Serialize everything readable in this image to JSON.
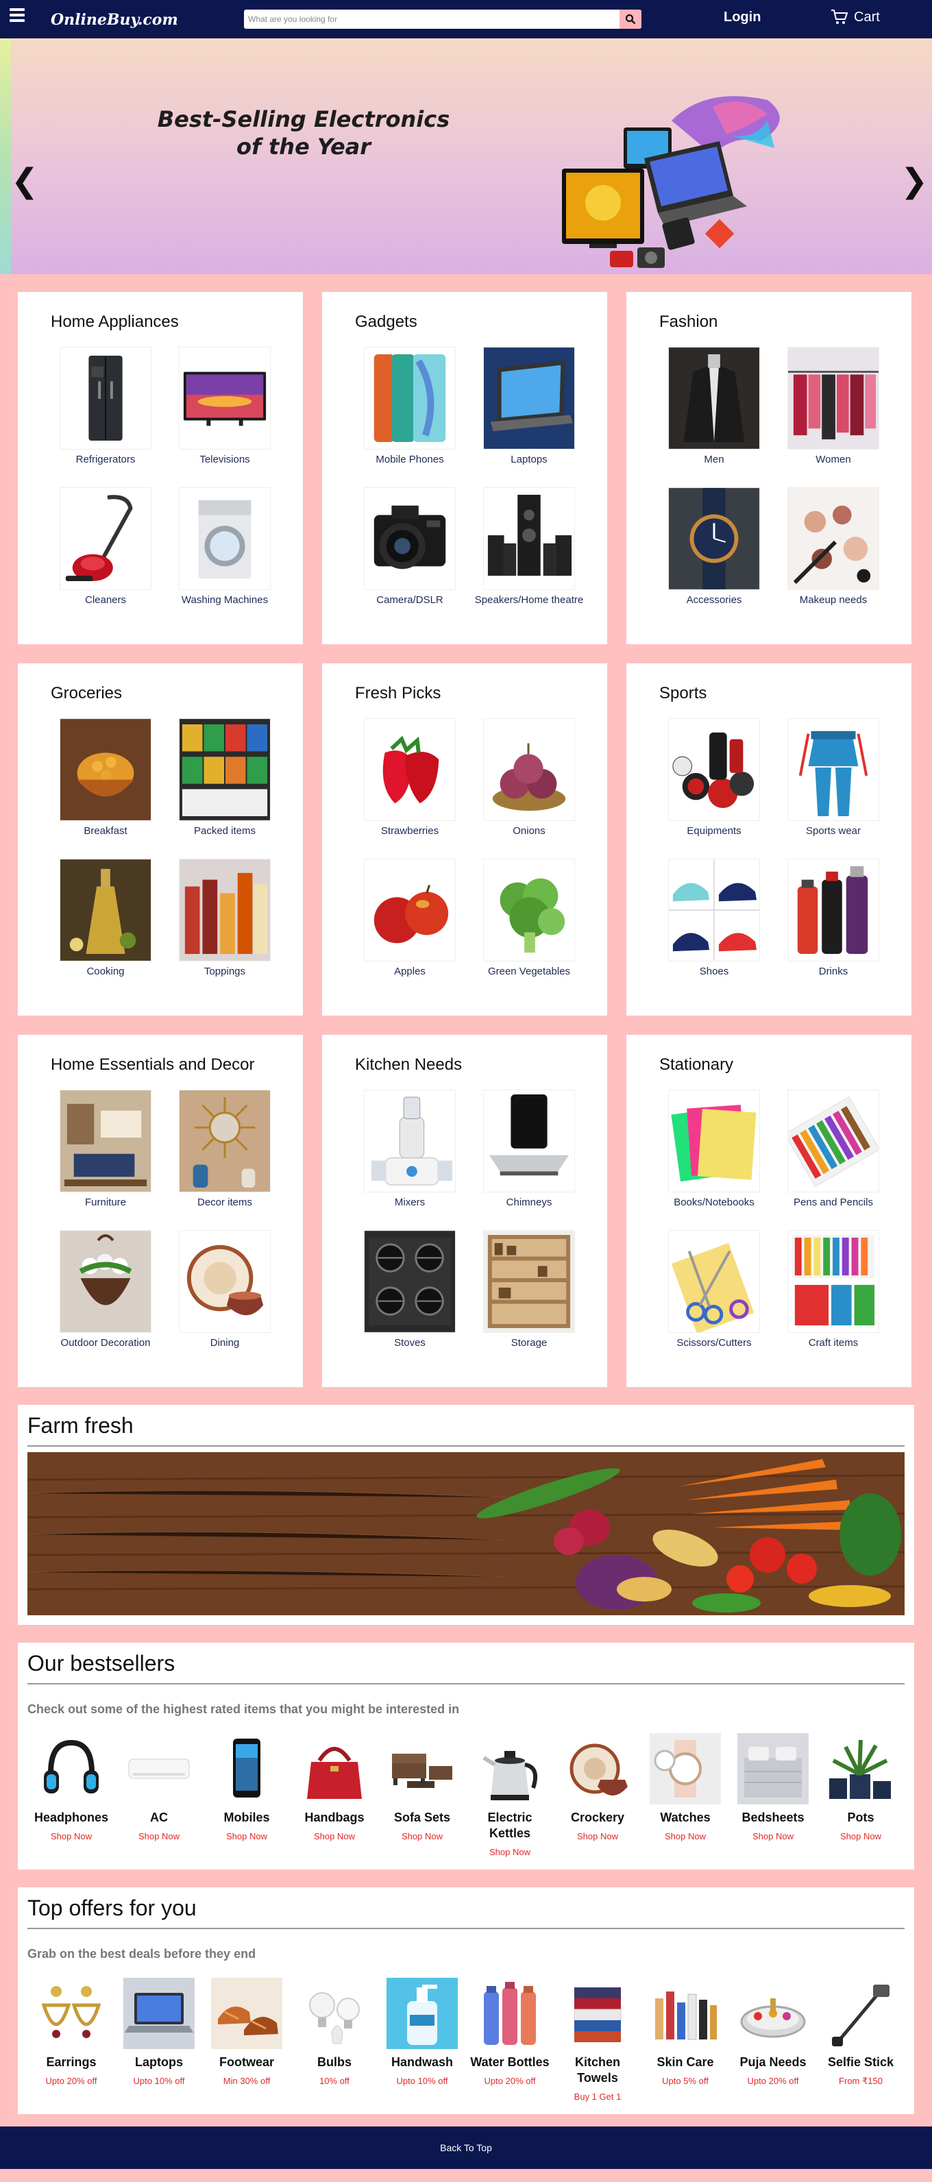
{
  "nav": {
    "logo": "OnlineBuy.com",
    "search_placeholder": "What are you looking for",
    "login": "Login",
    "cart": "Cart"
  },
  "hero": {
    "title_line1": "Best-Selling Electronics",
    "title_line2": "of the Year",
    "prev": "❮",
    "next": "❯"
  },
  "categories": [
    {
      "title": "Home Appliances",
      "items": [
        {
          "label": "Refrigerators",
          "icon": "fridge"
        },
        {
          "label": "Televisions",
          "icon": "tv"
        },
        {
          "label": "Cleaners",
          "icon": "vacuum"
        },
        {
          "label": "Washing Machines",
          "icon": "washer"
        }
      ]
    },
    {
      "title": "Gadgets",
      "items": [
        {
          "label": "Mobile Phones",
          "icon": "phones"
        },
        {
          "label": "Laptops",
          "icon": "laptop"
        },
        {
          "label": "Camera/DSLR",
          "icon": "camera"
        },
        {
          "label": "Speakers/Home theatre",
          "icon": "speakers"
        }
      ]
    },
    {
      "title": "Fashion",
      "items": [
        {
          "label": "Men",
          "icon": "jacket"
        },
        {
          "label": "Women",
          "icon": "rack"
        },
        {
          "label": "Accessories",
          "icon": "watch"
        },
        {
          "label": "Makeup needs",
          "icon": "makeup"
        }
      ]
    },
    {
      "title": "Groceries",
      "items": [
        {
          "label": "Breakfast",
          "icon": "cereal"
        },
        {
          "label": "Packed items",
          "icon": "shelf"
        },
        {
          "label": "Cooking",
          "icon": "oil"
        },
        {
          "label": "Toppings",
          "icon": "sauces"
        }
      ]
    },
    {
      "title": "Fresh Picks",
      "items": [
        {
          "label": "Strawberries",
          "icon": "strawberry"
        },
        {
          "label": "Onions",
          "icon": "onion"
        },
        {
          "label": "Apples",
          "icon": "apple"
        },
        {
          "label": "Green Vegetables",
          "icon": "broccoli"
        }
      ]
    },
    {
      "title": "Sports",
      "items": [
        {
          "label": "Equipments",
          "icon": "equipment"
        },
        {
          "label": "Sports wear",
          "icon": "tracksuit"
        },
        {
          "label": "Shoes",
          "icon": "shoes"
        },
        {
          "label": "Drinks",
          "icon": "drinks"
        }
      ]
    },
    {
      "title": "Home Essentials and Decor",
      "items": [
        {
          "label": "Furniture",
          "icon": "room"
        },
        {
          "label": "Decor items",
          "icon": "mirror"
        },
        {
          "label": "Outdoor Decoration",
          "icon": "planter"
        },
        {
          "label": "Dining",
          "icon": "dishes"
        }
      ]
    },
    {
      "title": "Kitchen Needs",
      "items": [
        {
          "label": "Mixers",
          "icon": "mixer"
        },
        {
          "label": "Chimneys",
          "icon": "chimney"
        },
        {
          "label": "Stoves",
          "icon": "stove"
        },
        {
          "label": "Storage",
          "icon": "pantry"
        }
      ]
    },
    {
      "title": "Stationary",
      "items": [
        {
          "label": "Books/Notebooks",
          "icon": "notebooks"
        },
        {
          "label": "Pens and Pencils",
          "icon": "pencils"
        },
        {
          "label": "Scissors/Cutters",
          "icon": "scissors"
        },
        {
          "label": "Craft items",
          "icon": "craft"
        }
      ]
    }
  ],
  "farm": {
    "title": "Farm fresh"
  },
  "bestsellers": {
    "title": "Our bestsellers",
    "subtitle": "Check out some of the highest rated items that you might be interested in",
    "items": [
      {
        "name": "Headphones",
        "link": "Shop Now",
        "icon": "headphones"
      },
      {
        "name": "AC",
        "link": "Shop Now",
        "icon": "ac"
      },
      {
        "name": "Mobiles",
        "link": "Shop Now",
        "icon": "mobile"
      },
      {
        "name": "Handbags",
        "link": "Shop Now",
        "icon": "handbag"
      },
      {
        "name": "Sofa Sets",
        "link": "Shop Now",
        "icon": "sofa"
      },
      {
        "name": "Electric Kettles",
        "link": "Shop Now",
        "icon": "kettle"
      },
      {
        "name": "Crockery",
        "link": "Shop Now",
        "icon": "crockery"
      },
      {
        "name": "Watches",
        "link": "Shop Now",
        "icon": "watches"
      },
      {
        "name": "Bedsheets",
        "link": "Shop Now",
        "icon": "bedsheet"
      },
      {
        "name": "Pots",
        "link": "Shop Now",
        "icon": "pots"
      }
    ]
  },
  "offers": {
    "title": "Top offers for you",
    "subtitle": "Grab on the best deals before they end",
    "items": [
      {
        "name": "Earrings",
        "link": "Upto 20% off",
        "icon": "earrings"
      },
      {
        "name": "Laptops",
        "link": "Upto 10% off",
        "icon": "laptop2"
      },
      {
        "name": "Footwear",
        "link": "Min 30% off",
        "icon": "footwear"
      },
      {
        "name": "Bulbs",
        "link": "10% off",
        "icon": "bulbs"
      },
      {
        "name": "Handwash",
        "link": "Upto 10% off",
        "icon": "handwash"
      },
      {
        "name": "Water Bottles",
        "link": "Upto 20% off",
        "icon": "bottles"
      },
      {
        "name": "Kitchen Towels",
        "link": "Buy 1 Get 1",
        "icon": "towels"
      },
      {
        "name": "Skin Care",
        "link": "Upto 5% off",
        "icon": "skincare"
      },
      {
        "name": "Puja Needs",
        "link": "Upto 20% off",
        "icon": "puja"
      },
      {
        "name": "Selfie Stick",
        "link": "From ₹150",
        "icon": "selfie"
      }
    ]
  },
  "footer": {
    "back_to_top": "Back To Top"
  },
  "colors": {
    "nav": "#0c1750",
    "page_bg": "#ffc0c0",
    "accent_red": "#e02828",
    "label": "#1f2a55"
  }
}
